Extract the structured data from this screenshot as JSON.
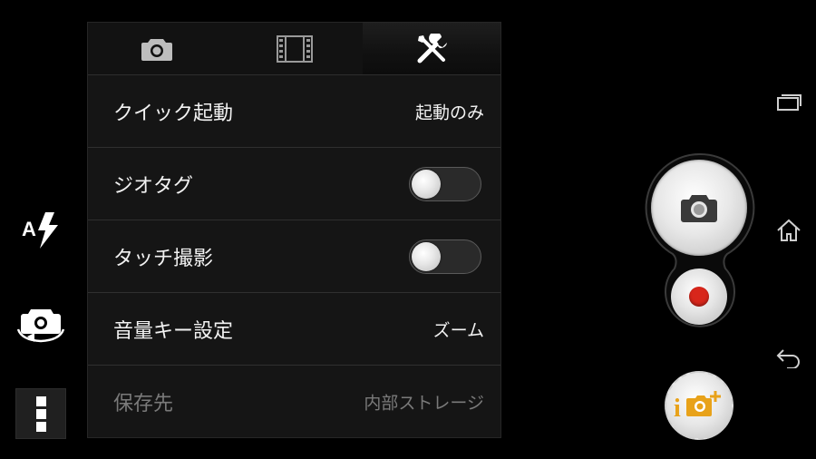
{
  "tabs": [
    {
      "icon": "camera-icon",
      "active": false
    },
    {
      "icon": "film-icon",
      "active": false
    },
    {
      "icon": "tools-icon",
      "active": true
    }
  ],
  "settings": {
    "quick_launch": {
      "label": "クイック起動",
      "value": "起動のみ"
    },
    "geotag": {
      "label": "ジオタグ",
      "on": false
    },
    "touch_capture": {
      "label": "タッチ撮影",
      "on": false
    },
    "volume_key": {
      "label": "音量キー設定",
      "value": "ズーム"
    },
    "storage": {
      "label": "保存先",
      "value": "内部ストレージ",
      "disabled": true
    }
  },
  "left_rail": {
    "flash_icon": "flash-auto-icon",
    "switch_icon": "switch-camera-icon",
    "menu_icon": "more-vertical-icon"
  },
  "colors": {
    "record": "#d8261b",
    "apps_accent": "#e8a21a"
  }
}
